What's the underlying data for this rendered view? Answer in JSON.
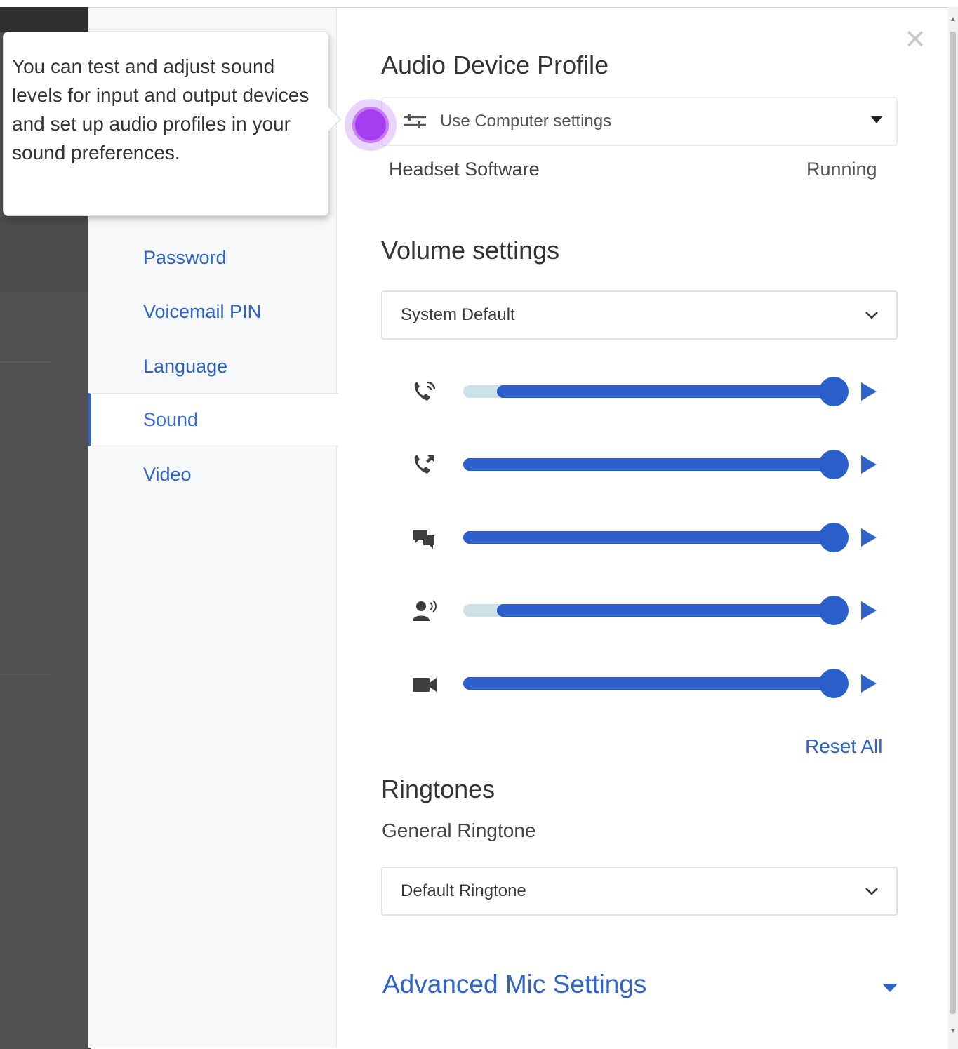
{
  "tooltip": {
    "text": "You can test and adjust sound levels for input and output devices and set up audio profiles in your sound preferences."
  },
  "sidebar": {
    "items": [
      {
        "label": "Password",
        "active": false
      },
      {
        "label": "Voicemail PIN",
        "active": false
      },
      {
        "label": "Language",
        "active": false
      },
      {
        "label": "Sound",
        "active": true
      },
      {
        "label": "Video",
        "active": false
      }
    ]
  },
  "audio_profile": {
    "heading": "Audio Device Profile",
    "selected": "Use Computer settings",
    "status_label": "Headset Software",
    "status_value": "Running"
  },
  "volume": {
    "heading": "Volume settings",
    "device": "System Default",
    "sliders": [
      {
        "icon": "phone-ring-icon",
        "level_percent": 100
      },
      {
        "icon": "phone-forward-icon",
        "level_percent": 100
      },
      {
        "icon": "chat-bubbles-icon",
        "level_percent": 100
      },
      {
        "icon": "person-speaking-icon",
        "level_percent": 100
      },
      {
        "icon": "video-camera-icon",
        "level_percent": 100
      }
    ],
    "reset_label": "Reset All"
  },
  "ringtones": {
    "heading": "Ringtones",
    "general_label": "General Ringtone",
    "selected": "Default Ringtone"
  },
  "advanced": {
    "label": "Advanced Mic Settings"
  },
  "colors": {
    "accent": "#2e63c7",
    "slider": "#2a5fcc",
    "beacon": "#a33ff0"
  }
}
